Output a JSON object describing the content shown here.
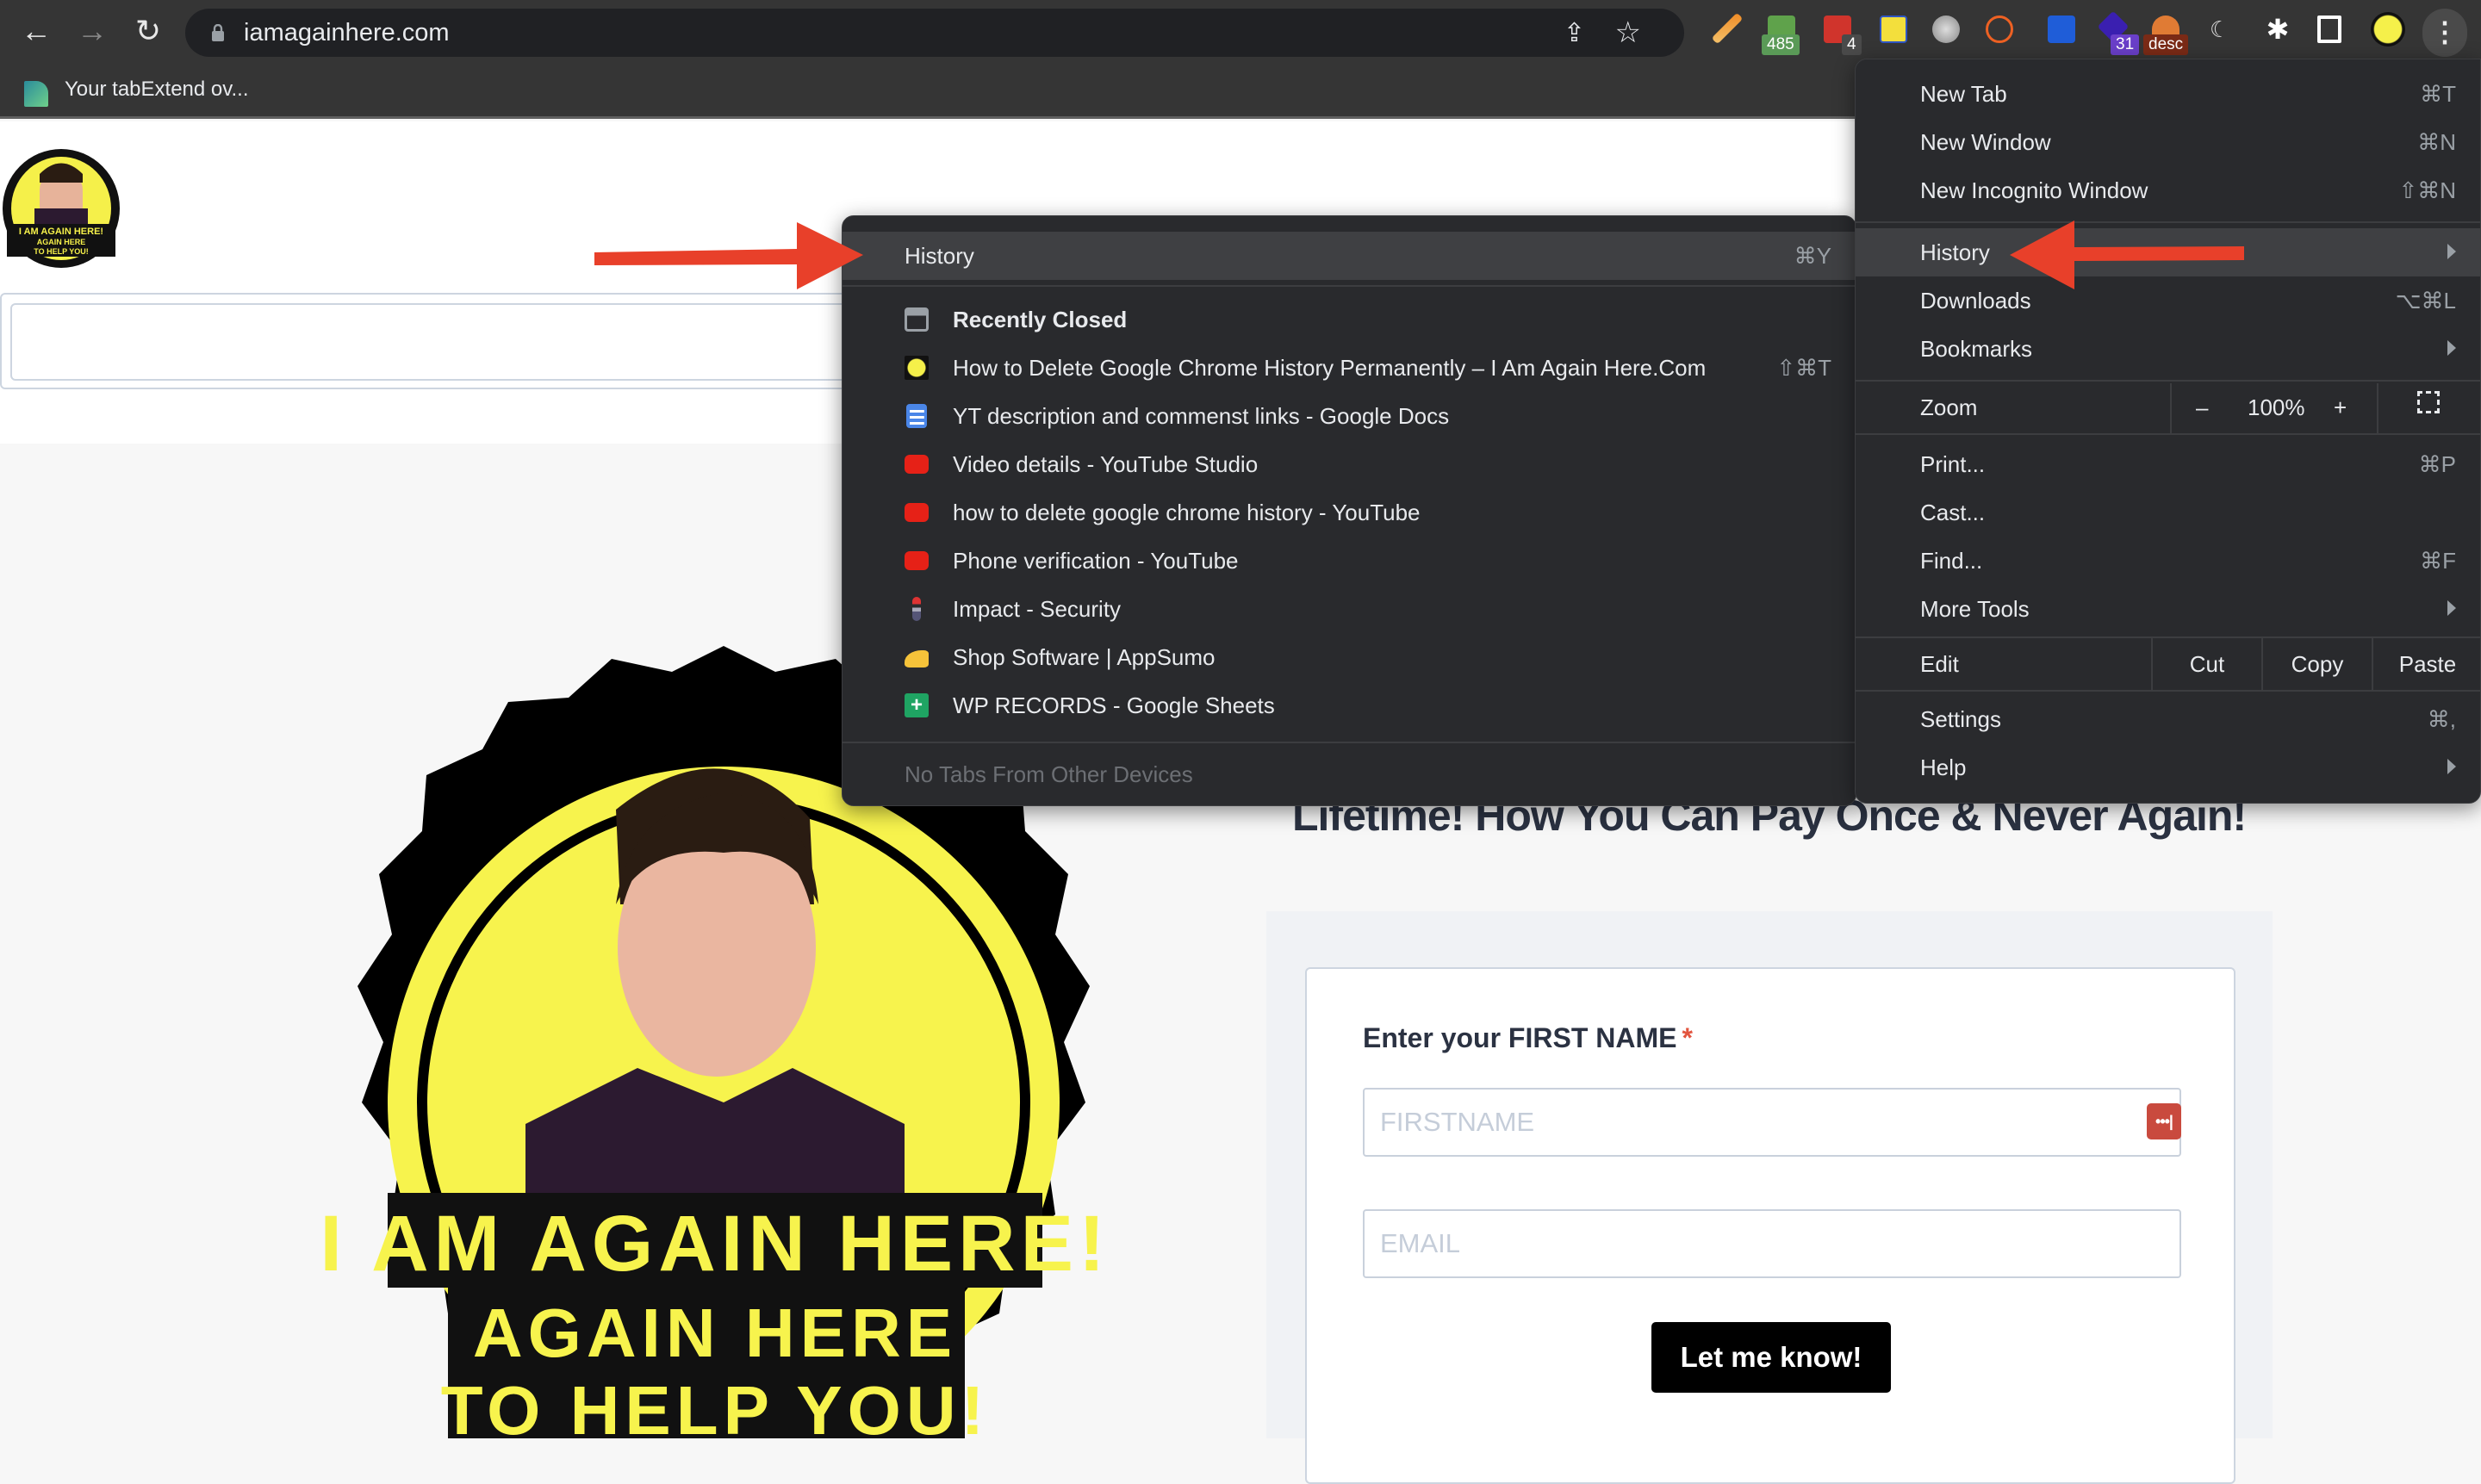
{
  "browser": {
    "url": "iamagainhere.com",
    "nav": {
      "back_icon": "arrow-left-icon",
      "forward_icon": "arrow-right-icon",
      "reload_icon": "reload-icon"
    },
    "extensions": [
      {
        "name": "pencil-extension",
        "badge": ""
      },
      {
        "name": "timer-extension",
        "badge": "485"
      },
      {
        "name": "lastpass-extension",
        "badge": "4"
      },
      {
        "name": "notes-extension",
        "badge": ""
      },
      {
        "name": "speechify-extension",
        "badge": ""
      },
      {
        "name": "bitly-extension",
        "badge": ""
      },
      {
        "name": "bitwarden-extension",
        "badge": ""
      },
      {
        "name": "purple-extension",
        "badge": "31"
      },
      {
        "name": "bell-extension",
        "badge": "desc"
      },
      {
        "name": "moon-extension",
        "badge": ""
      }
    ],
    "bookmark": {
      "label": "Your tabExtend ov..."
    }
  },
  "main_menu": {
    "items": [
      {
        "label": "New Tab",
        "shortcut": "⌘T"
      },
      {
        "label": "New Window",
        "shortcut": "⌘N"
      },
      {
        "label": "New Incognito Window",
        "shortcut": "⇧⌘N"
      },
      {
        "label": "History",
        "shortcut": ""
      },
      {
        "label": "Downloads",
        "shortcut": "⌥⌘L"
      },
      {
        "label": "Bookmarks",
        "shortcut": ""
      },
      {
        "label": "Zoom",
        "shortcut": ""
      },
      {
        "label": "Print...",
        "shortcut": "⌘P"
      },
      {
        "label": "Cast...",
        "shortcut": ""
      },
      {
        "label": "Find...",
        "shortcut": "⌘F"
      },
      {
        "label": "More Tools",
        "shortcut": ""
      },
      {
        "label": "Edit",
        "shortcut": ""
      },
      {
        "label": "Settings",
        "shortcut": "⌘,"
      },
      {
        "label": "Help",
        "shortcut": ""
      }
    ],
    "zoom": {
      "minus": "–",
      "value": "100%",
      "plus": "+"
    },
    "edit": {
      "cut": "Cut",
      "copy": "Copy",
      "paste": "Paste"
    }
  },
  "history_menu": {
    "header": {
      "label": "History",
      "shortcut": "⌘Y"
    },
    "recently_closed_label": "Recently Closed",
    "entries": [
      {
        "title": "How to Delete Google Chrome History Permanently – I Am Again Here.Com",
        "shortcut": "⇧⌘T",
        "icon": "site-logo-icon"
      },
      {
        "title": "YT description and commenst links - Google Docs",
        "shortcut": "",
        "icon": "google-docs-icon"
      },
      {
        "title": "Video details - YouTube Studio",
        "shortcut": "",
        "icon": "youtube-icon"
      },
      {
        "title": "how to delete google chrome history - YouTube",
        "shortcut": "",
        "icon": "youtube-icon"
      },
      {
        "title": "Phone verification - YouTube",
        "shortcut": "",
        "icon": "youtube-icon"
      },
      {
        "title": "Impact - Security",
        "shortcut": "",
        "icon": "impact-icon"
      },
      {
        "title": "Shop Software | AppSumo",
        "shortcut": "",
        "icon": "appsumo-icon"
      },
      {
        "title": "WP RECORDS - Google Sheets",
        "shortcut": "",
        "icon": "google-sheets-icon"
      }
    ],
    "other_devices": "No Tabs From Other Devices"
  },
  "page": {
    "logo_text": [
      "I AM AGAIN HERE!",
      "AGAIN HERE",
      "TO HELP YOU!"
    ],
    "headline": "Lifetime! How You Can Pay Once & Never Again!",
    "form": {
      "first_name_label": "Enter your FIRST NAME",
      "required_mark": "*",
      "first_name_placeholder": "FIRSTNAME",
      "first_name_value": "",
      "email_placeholder": "EMAIL",
      "email_value": "",
      "submit_label": "Let me know!"
    }
  },
  "colors": {
    "menu_bg": "#292a2d",
    "menu_highlight": "#3f4043",
    "annotation_arrow": "#e8402a",
    "headline": "#2b3242",
    "button": "#000000",
    "required": "#e2553f"
  }
}
